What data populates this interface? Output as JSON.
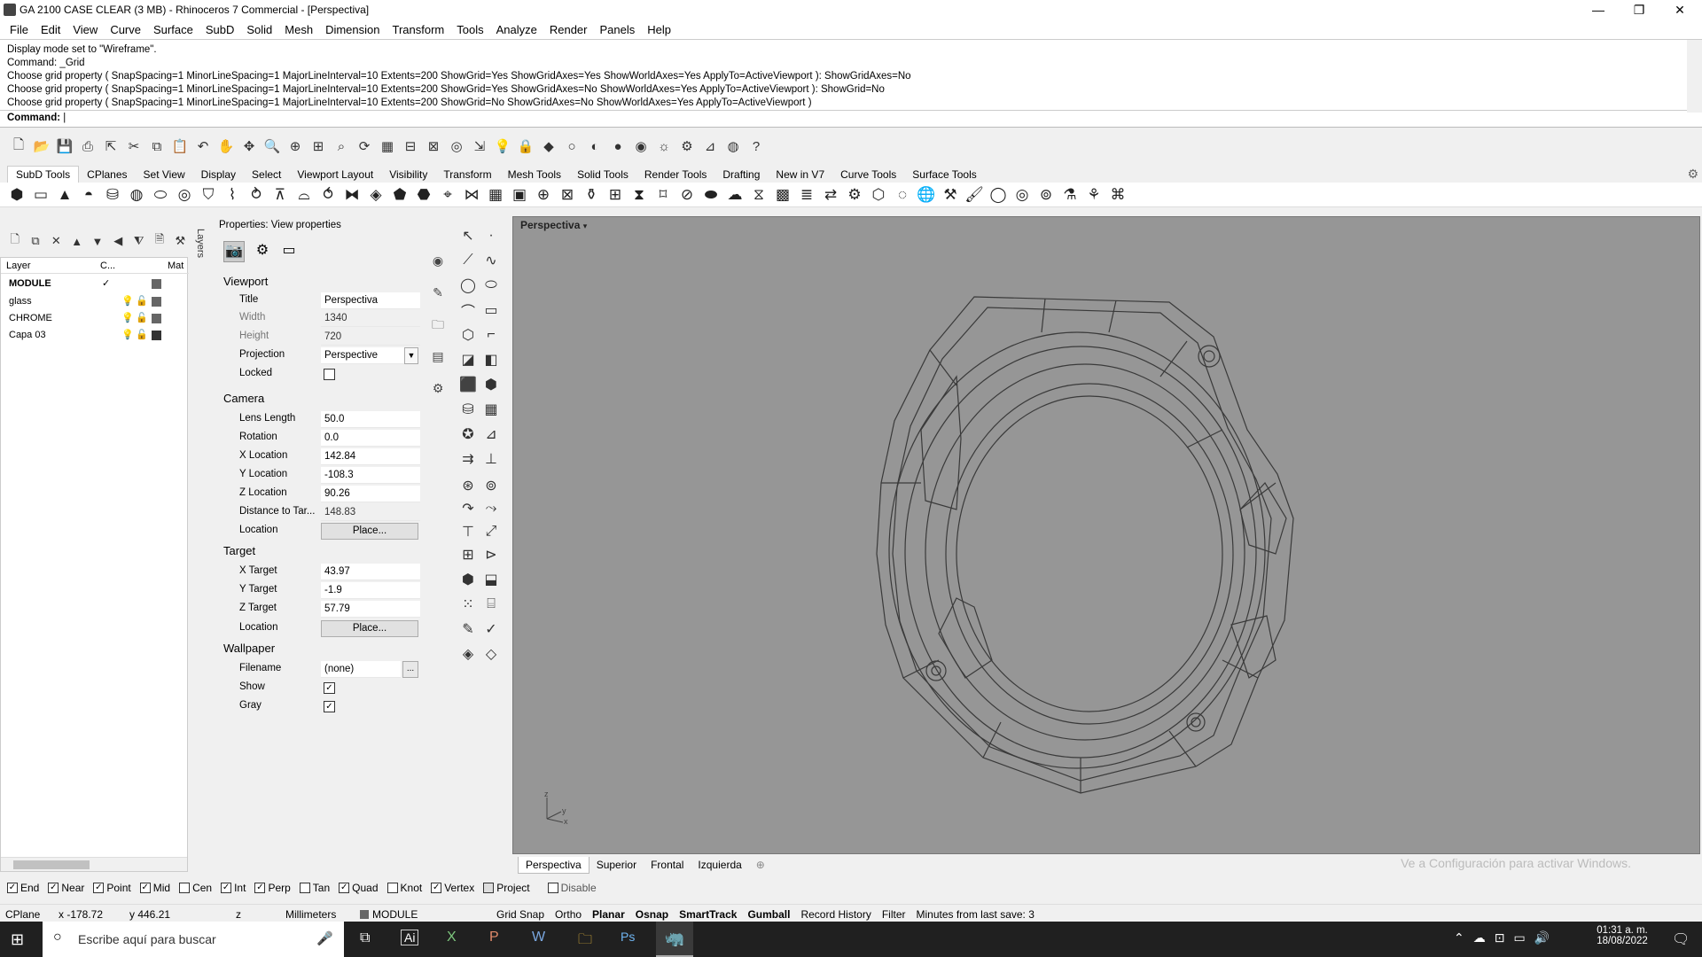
{
  "window": {
    "title": "GA 2100 CASE CLEAR (3 MB) - Rhinoceros 7 Commercial - [Perspectiva]",
    "minimize": "—",
    "restore": "❐",
    "close": "✕"
  },
  "menu": [
    "File",
    "Edit",
    "View",
    "Curve",
    "Surface",
    "SubD",
    "Solid",
    "Mesh",
    "Dimension",
    "Transform",
    "Tools",
    "Analyze",
    "Render",
    "Panels",
    "Help"
  ],
  "command_history": [
    "Display mode set to \"Wireframe\".",
    "Command: _Grid",
    "Choose grid property ( SnapSpacing=1  MinorLineSpacing=1  MajorLineInterval=10  Extents=200  ShowGrid=Yes  ShowGridAxes=Yes  ShowWorldAxes=Yes  ApplyTo=ActiveViewport ): ShowGridAxes=No",
    "Choose grid property ( SnapSpacing=1  MinorLineSpacing=1  MajorLineInterval=10  Extents=200  ShowGrid=Yes  ShowGridAxes=No  ShowWorldAxes=Yes  ApplyTo=ActiveViewport ): ShowGrid=No",
    "Choose grid property ( SnapSpacing=1  MinorLineSpacing=1  MajorLineInterval=10  Extents=200  ShowGrid=No  ShowGridAxes=No  ShowWorldAxes=Yes  ApplyTo=ActiveViewport )"
  ],
  "command_prompt": "Command:",
  "toolbar_tabs": [
    "SubD Tools",
    "CPlanes",
    "Set View",
    "Display",
    "Select",
    "Viewport Layout",
    "Visibility",
    "Transform",
    "Mesh Tools",
    "Solid Tools",
    "Render Tools",
    "Drafting",
    "New in V7",
    "Curve Tools",
    "Surface Tools"
  ],
  "layers": {
    "headers": {
      "layer": "Layer",
      "current": "C...",
      "material": "Mat"
    },
    "side_tab": "Layers",
    "rows": [
      {
        "name": "MODULE",
        "current": "✓",
        "bold": true
      },
      {
        "name": "glass",
        "current": ""
      },
      {
        "name": "CHROME",
        "current": ""
      },
      {
        "name": "Capa 03",
        "current": ""
      }
    ]
  },
  "properties": {
    "title": "Properties: View properties",
    "viewport_section": "Viewport",
    "title_label": "Title",
    "title_value": "Perspectiva",
    "width_label": "Width",
    "width_value": "1340",
    "height_label": "Height",
    "height_value": "720",
    "projection_label": "Projection",
    "projection_value": "Perspective",
    "locked_label": "Locked",
    "camera_section": "Camera",
    "lens_label": "Lens Length",
    "lens_value": "50.0",
    "rotation_label": "Rotation",
    "rotation_value": "0.0",
    "xloc_label": "X Location",
    "xloc_value": "142.84",
    "yloc_label": "Y Location",
    "yloc_value": "-108.3",
    "zloc_label": "Z Location",
    "zloc_value": "90.26",
    "dist_label": "Distance to Tar...",
    "dist_value": "148.83",
    "location_label": "Location",
    "place_label": "Place...",
    "target_section": "Target",
    "xt_label": "X Target",
    "xt_value": "43.97",
    "yt_label": "Y Target",
    "yt_value": "-1.9",
    "zt_label": "Z Target",
    "zt_value": "57.79",
    "tlocation_label": "Location",
    "tplace_label": "Place...",
    "wallpaper_section": "Wallpaper",
    "filename_label": "Filename",
    "filename_value": "(none)",
    "browse_label": "...",
    "show_label": "Show",
    "gray_label": "Gray"
  },
  "viewport": {
    "name": "Perspectiva",
    "tabs": [
      "Perspectiva",
      "Superior",
      "Frontal",
      "Izquierda"
    ],
    "add_tab": "⊕",
    "watermark": "Ve a Configuración para activar Windows."
  },
  "osnap": [
    {
      "label": "End",
      "checked": true
    },
    {
      "label": "Near",
      "checked": true
    },
    {
      "label": "Point",
      "checked": true
    },
    {
      "label": "Mid",
      "checked": true
    },
    {
      "label": "Cen",
      "checked": false
    },
    {
      "label": "Int",
      "checked": true
    },
    {
      "label": "Perp",
      "checked": true
    },
    {
      "label": "Tan",
      "checked": false
    },
    {
      "label": "Quad",
      "checked": true
    },
    {
      "label": "Knot",
      "checked": false
    },
    {
      "label": "Vertex",
      "checked": true
    },
    {
      "label": "Project",
      "checked": false
    },
    {
      "label": "Disable",
      "checked": false
    }
  ],
  "status": {
    "cplane": "CPlane",
    "x": "x -178.72",
    "y": "y 446.21",
    "z": "z",
    "units": "Millimeters",
    "layer": "MODULE",
    "grid_snap": "Grid Snap",
    "ortho": "Ortho",
    "planar": "Planar",
    "osnap": "Osnap",
    "smarttrack": "SmartTrack",
    "gumball": "Gumball",
    "record_history": "Record History",
    "filter": "Filter",
    "minutes": "Minutes from last save: 3"
  },
  "taskbar": {
    "search_placeholder": "Escribe aquí para buscar",
    "time": "01:31 a. m.",
    "date": "18/08/2022"
  }
}
